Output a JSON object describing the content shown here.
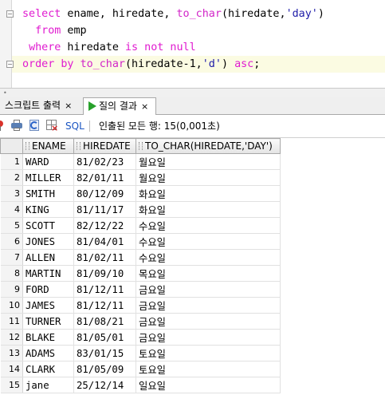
{
  "editor": {
    "lines": [
      {
        "segments": [
          {
            "t": "select",
            "k": "kw"
          },
          {
            "t": " ename, hiredate, "
          },
          {
            "t": "to_char",
            "k": "fn"
          },
          {
            "t": "(hiredate,"
          },
          {
            "t": "'day'",
            "k": "str"
          },
          {
            "t": ")"
          }
        ]
      },
      {
        "segments": [
          {
            "t": "  "
          },
          {
            "t": "from",
            "k": "kw"
          },
          {
            "t": " emp"
          }
        ]
      },
      {
        "segments": [
          {
            "t": " "
          },
          {
            "t": "where",
            "k": "kw"
          },
          {
            "t": " hiredate "
          },
          {
            "t": "is not null",
            "k": "kw"
          }
        ]
      },
      {
        "segments": [
          {
            "t": "order by",
            "k": "kw"
          },
          {
            "t": " "
          },
          {
            "t": "to_char",
            "k": "fn"
          },
          {
            "t": "(hiredate-1,"
          },
          {
            "t": "'d'",
            "k": "str"
          },
          {
            "t": ") "
          },
          {
            "t": "asc",
            "k": "kw"
          },
          {
            "t": ";"
          }
        ]
      }
    ],
    "fold_glyph": "−"
  },
  "tabs": {
    "script_output": {
      "label": "스크립트 출력",
      "close": "×"
    },
    "query_result": {
      "label": "질의 결과",
      "close": "×"
    }
  },
  "toolbar": {
    "sql_label": "SQL",
    "status": "인출된 모든 행: 15(0,001초)"
  },
  "grid": {
    "columns": [
      "ENAME",
      "HIREDATE",
      "TO_CHAR(HIREDATE,'DAY')"
    ],
    "rows": [
      [
        "1",
        "WARD",
        "81/02/23",
        "월요일"
      ],
      [
        "2",
        "MILLER",
        "82/01/11",
        "월요일"
      ],
      [
        "3",
        "SMITH",
        "80/12/09",
        "화요일"
      ],
      [
        "4",
        "KING",
        "81/11/17",
        "화요일"
      ],
      [
        "5",
        "SCOTT",
        "82/12/22",
        "수요일"
      ],
      [
        "6",
        "JONES",
        "81/04/01",
        "수요일"
      ],
      [
        "7",
        "ALLEN",
        "81/02/11",
        "수요일"
      ],
      [
        "8",
        "MARTIN",
        "81/09/10",
        "목요일"
      ],
      [
        "9",
        "FORD",
        "81/12/11",
        "금요일"
      ],
      [
        "10",
        "JAMES",
        "81/12/11",
        "금요일"
      ],
      [
        "11",
        "TURNER",
        "81/08/21",
        "금요일"
      ],
      [
        "12",
        "BLAKE",
        "81/05/01",
        "금요일"
      ],
      [
        "13",
        "ADAMS",
        "83/01/15",
        "토요일"
      ],
      [
        "14",
        "CLARK",
        "81/05/09",
        "토요일"
      ],
      [
        "15",
        "jane",
        "25/12/14",
        "일요일"
      ]
    ]
  },
  "icons": [
    "pin-icon",
    "print-icon",
    "refresh-icon",
    "export-grid-icon",
    "play-icon"
  ]
}
